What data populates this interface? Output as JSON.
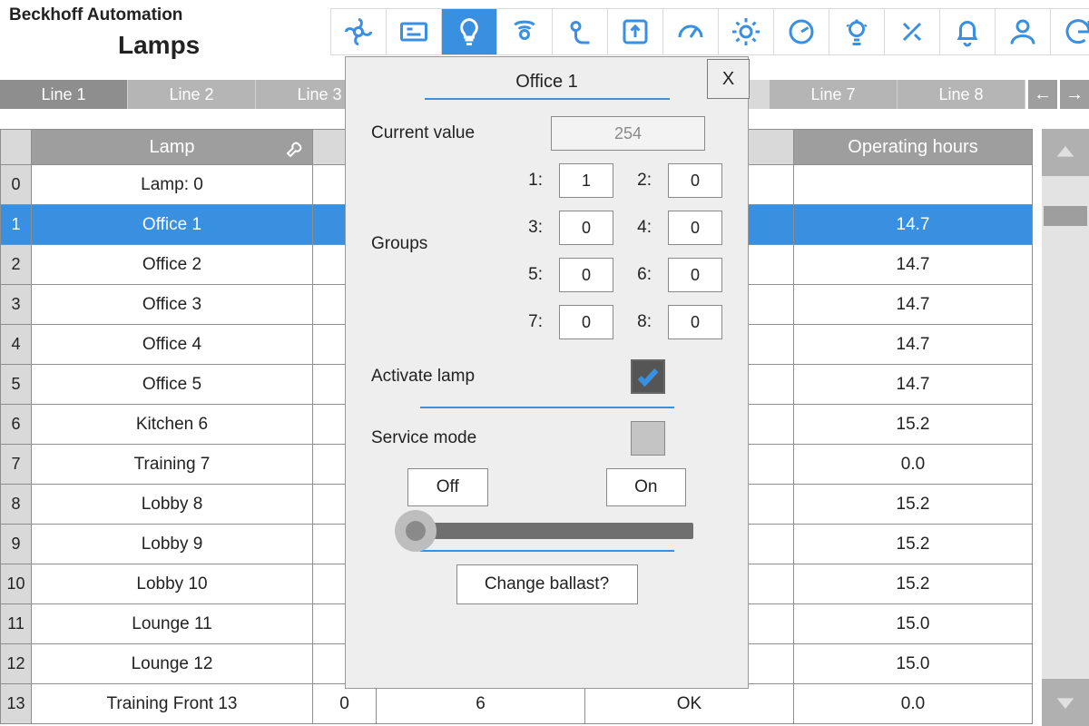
{
  "brand": "Beckhoff Automation",
  "page_title": "Lamps",
  "toolbar": {
    "icons": [
      "fan",
      "card",
      "bulb",
      "sensor",
      "hand",
      "switch",
      "gauge",
      "sun",
      "dial",
      "gearbulb",
      "tools",
      "bell",
      "person",
      "undo"
    ],
    "active_index": 2
  },
  "lines": [
    "Line 1",
    "Line 2",
    "Line 3",
    "",
    "",
    "",
    "Line 7",
    "Line 8"
  ],
  "table": {
    "header_lamp": "Lamp",
    "header_hours": "Operating hours",
    "rows": [
      {
        "idx": "0",
        "lamp": "Lamp: 0",
        "mid": [
          "",
          "",
          ""
        ],
        "hours": ""
      },
      {
        "idx": "1",
        "lamp": "Office 1",
        "mid": [
          "",
          "",
          ""
        ],
        "hours": "14.7",
        "selected": true
      },
      {
        "idx": "2",
        "lamp": "Office 2",
        "mid": [
          "",
          "",
          ""
        ],
        "hours": "14.7"
      },
      {
        "idx": "3",
        "lamp": "Office 3",
        "mid": [
          "",
          "",
          ""
        ],
        "hours": "14.7"
      },
      {
        "idx": "4",
        "lamp": "Office 4",
        "mid": [
          "",
          "",
          ""
        ],
        "hours": "14.7"
      },
      {
        "idx": "5",
        "lamp": "Office 5",
        "mid": [
          "",
          "",
          ""
        ],
        "hours": "14.7"
      },
      {
        "idx": "6",
        "lamp": "Kitchen 6",
        "mid": [
          "",
          "",
          ""
        ],
        "hours": "15.2"
      },
      {
        "idx": "7",
        "lamp": "Training 7",
        "mid": [
          "",
          "",
          ""
        ],
        "hours": "0.0"
      },
      {
        "idx": "8",
        "lamp": "Lobby 8",
        "mid": [
          "",
          "",
          ""
        ],
        "hours": "15.2"
      },
      {
        "idx": "9",
        "lamp": "Lobby 9",
        "mid": [
          "",
          "",
          ""
        ],
        "hours": "15.2"
      },
      {
        "idx": "10",
        "lamp": "Lobby 10",
        "mid": [
          "",
          "",
          ""
        ],
        "hours": "15.2"
      },
      {
        "idx": "11",
        "lamp": "Lounge 11",
        "mid": [
          "",
          "",
          ""
        ],
        "hours": "15.0"
      },
      {
        "idx": "12",
        "lamp": "Lounge 12",
        "mid": [
          "",
          "",
          ""
        ],
        "hours": "15.0"
      },
      {
        "idx": "13",
        "lamp": "Training Front 13",
        "mid": [
          "0",
          "6",
          "OK"
        ],
        "hours": "0.0"
      }
    ]
  },
  "dialog": {
    "title": "Office 1",
    "close": "X",
    "current_label": "Current value",
    "current_value": "254",
    "groups_label": "Groups",
    "groups": [
      {
        "k": "1:",
        "v": "1"
      },
      {
        "k": "2:",
        "v": "0"
      },
      {
        "k": "3:",
        "v": "0"
      },
      {
        "k": "4:",
        "v": "0"
      },
      {
        "k": "5:",
        "v": "0"
      },
      {
        "k": "6:",
        "v": "0"
      },
      {
        "k": "7:",
        "v": "0"
      },
      {
        "k": "8:",
        "v": "0"
      }
    ],
    "activate_label": "Activate lamp",
    "service_label": "Service mode",
    "off": "Off",
    "on": "On",
    "ballast": "Change ballast?"
  }
}
